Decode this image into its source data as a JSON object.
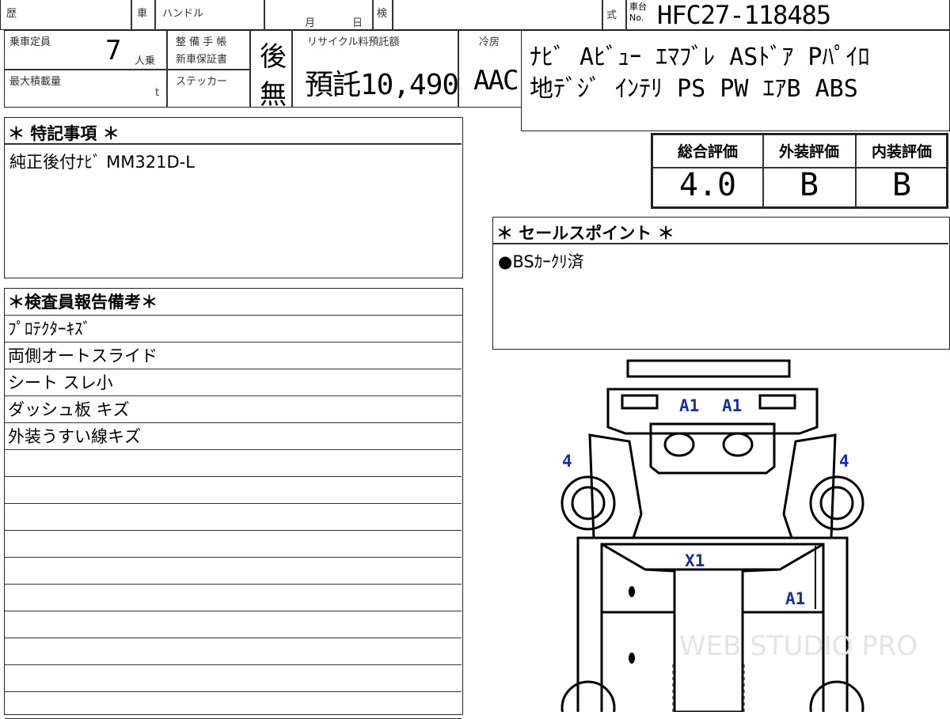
{
  "header": {
    "history_label": "歴",
    "car_label": "車",
    "handle_label": "ハンドル",
    "month_label": "月",
    "day_label": "日",
    "inspect_label": "検",
    "type_label": "式",
    "chassis_label_top": "車台",
    "chassis_label_bottom": "No.",
    "chassis_no": "HFC27-118485"
  },
  "row2": {
    "capacity_label": "乗車定員",
    "capacity_value": "7",
    "capacity_unit": "人乗",
    "maint_label_1": "整 備 手 帳",
    "maint_label_2": "新車保証書",
    "maint_value": "後",
    "recycle_label": "リサイクル料預託額",
    "recycle_value": "預託10,490",
    "cooler_label": "冷房",
    "cooler_value": "AAC",
    "maxload_label": "最大積載量",
    "maxload_unit": "t",
    "sticker_label": "ステッカー",
    "sticker_value": "無"
  },
  "equipment": {
    "line1": "ﾅﾋﾞ Aﾋﾞｭｰ ｴﾏﾌﾞﾚ ASﾄﾞｱ Pﾊﾟｲﾛ",
    "line2": "地ﾃﾞｼﾞ ｲﾝﾃﾘ PS PW ｴｱB ABS"
  },
  "ratings": {
    "overall_label": "総合評価",
    "overall_value": "4.0",
    "exterior_label": "外装評価",
    "exterior_value": "B",
    "interior_label": "内装評価",
    "interior_value": "B"
  },
  "special": {
    "title": "＊ 特記事項 ＊",
    "text": "純正後付ﾅﾋﾞ MM321D-L"
  },
  "sales": {
    "title": "＊ セールスポイント ＊",
    "text": "●BSｶｰｸﾘ済"
  },
  "inspector": {
    "title": "＊検査員報告備考＊",
    "lines": [
      "ﾌﾟﾛﾃｸﾀｰｷｽﾞ",
      "両側オートスライド",
      "シート スレ小",
      "ダッシュ板 キズ",
      "外装うすい線キズ",
      "",
      "",
      "",
      "",
      "",
      "",
      "",
      "",
      "",
      ""
    ]
  },
  "diagram": {
    "marks": {
      "bumper_left": "A1",
      "bumper_right": "A1",
      "front_left": "4",
      "front_right": "4",
      "roof": "X1",
      "right_side": "A1"
    }
  },
  "watermark": "WEB STUDIO PRO"
}
